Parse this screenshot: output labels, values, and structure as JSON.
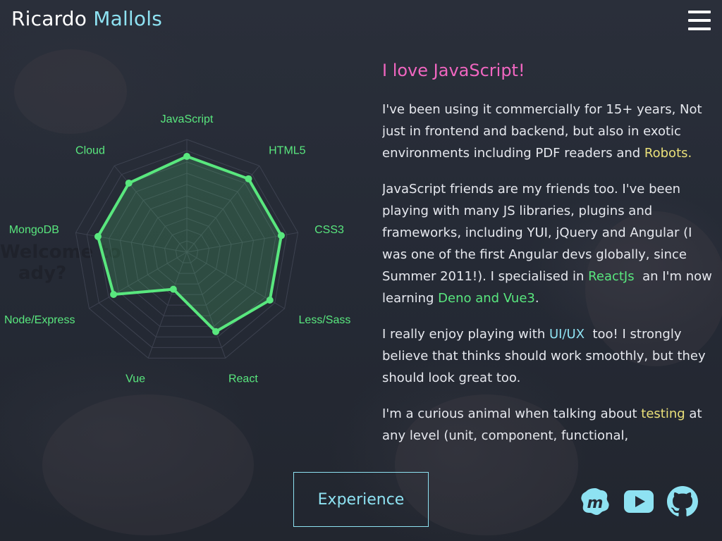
{
  "header": {
    "first_name": "Ricardo",
    "last_name": "Mallols"
  },
  "radar": {
    "labels": [
      "JavaScript",
      "HTML5",
      "CSS3",
      "Less/Sass",
      "React",
      "Vue",
      "Node/Express",
      "MongoDB",
      "Cloud"
    ],
    "values": [
      0.85,
      0.85,
      0.85,
      0.85,
      0.75,
      0.35,
      0.75,
      0.8,
      0.8
    ],
    "max": 1,
    "rings": 10,
    "color": "#59e77e",
    "fill": "rgba(89,231,126,0.18)",
    "grid_color": "#3d4250"
  },
  "content": {
    "headline": "I love JavaScript!",
    "p1": {
      "text": "I've been using it commercially for 15+ years, Not just in frontend and backend, but also in exotic environments including PDF readers and ",
      "link": "Robots."
    },
    "p2": {
      "text1": "JavaScript friends are my friends too. I've been playing with many JS libraries, plugins and frameworks, including YUI, jQuery and Angular (I was one of the first Angular devs globally, since Summer 2011!). I specialised in ",
      "link1": "ReactJs",
      "text2": "  an I'm now learning ",
      "link2": "Deno and Vue3",
      "text3": "."
    },
    "p3": {
      "text1": "I really enjoy playing with ",
      "link": "UI/UX",
      "text2": "  too! I strongly believe that thinks should work smoothly, but they should look great too."
    },
    "p4": {
      "text1": "I'm a curious animal when talking about ",
      "link": "testing",
      "text2": " at any level (unit, component, functional, integration...even"
    }
  },
  "experience_button": "Experience",
  "social": {
    "meetup_icon": "meetup-icon",
    "youtube_icon": "youtube-icon",
    "github_icon": "github-icon",
    "icon_color": "#8ee2f2"
  },
  "background_ghost_text": [
    "Welcome to",
    "ady?"
  ]
}
